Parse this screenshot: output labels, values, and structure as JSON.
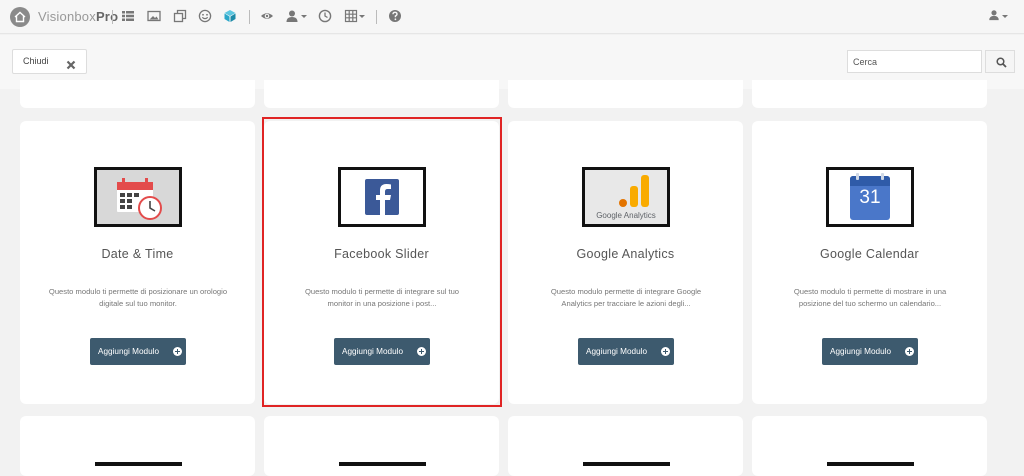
{
  "app": {
    "brand_light": "Visionbox",
    "brand_bold": "Pro"
  },
  "toolbar": {
    "icons": [
      "list-icon",
      "image-icon",
      "copy-icon",
      "smiley-icon",
      "cube-icon",
      "eye-icon",
      "user-icon",
      "clock-icon",
      "grid-icon",
      "help-icon"
    ],
    "accent": "#2aa7c9"
  },
  "subbar": {
    "close_label": "Chiudi",
    "search_placeholder": "Cerca"
  },
  "modules": [
    {
      "title": "Date & Time",
      "description": "Questo modulo ti permette di posizionare un orologio digitale sul tuo monitor.",
      "button": "Aggiungi Modulo"
    },
    {
      "title": "Facebook Slider",
      "description": "Questo modulo ti permette di integrare sul tuo monitor in una posizione i post...",
      "button": "Aggiungi Modulo"
    },
    {
      "title": "Google Analytics",
      "description": "Questo modulo permette di integrare Google Analytics per tracciare le azioni degli...",
      "button": "Aggiungi Modulo",
      "thumb_text": "Google Analytics"
    },
    {
      "title": "Google Calendar",
      "description": "Questo modulo ti permette di mostrare in una posizione del tuo schermo un calendario...",
      "button": "Aggiungi Modulo",
      "thumb_text": "31"
    }
  ],
  "colors": {
    "button_bg": "#3d5a6e",
    "highlight": "#e02424"
  }
}
